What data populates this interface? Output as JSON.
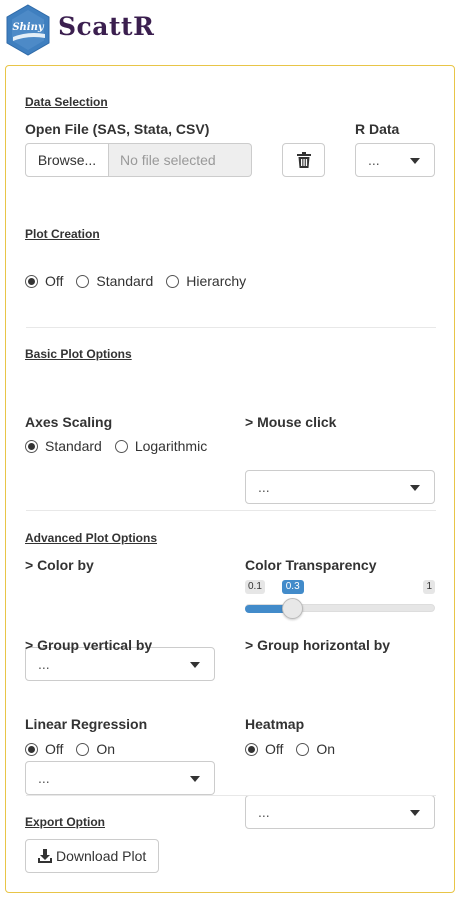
{
  "app": {
    "title": "ScattR",
    "logo_text": "Shiny"
  },
  "data_selection": {
    "section_title": "Data Selection",
    "open_file_label": "Open File (SAS, Stata, CSV)",
    "browse_label": "Browse...",
    "file_placeholder": "No file selected",
    "r_data_label": "R Data",
    "r_data_selected": "..."
  },
  "plot_creation": {
    "section_title": "Plot Creation",
    "options": [
      "Off",
      "Standard",
      "Hierarchy"
    ],
    "selected": "Off"
  },
  "basic_options": {
    "section_title": "Basic Plot Options",
    "axes_scaling_label": "Axes Scaling",
    "axes_options": [
      "Standard",
      "Logarithmic"
    ],
    "axes_selected": "Standard",
    "mouse_click_label": "> Mouse click",
    "mouse_click_selected": "..."
  },
  "advanced_options": {
    "section_title": "Advanced Plot Options",
    "color_by_label": "> Color by",
    "color_by_selected": "...",
    "transparency_label": "Color Transparency",
    "transparency_min": "0.1",
    "transparency_max": "1",
    "transparency_value": "0.3",
    "transparency_fraction": 0.222,
    "group_vertical_label": "> Group vertical by",
    "group_vertical_selected": "...",
    "group_horizontal_label": "> Group horizontal by",
    "group_horizontal_selected": "...",
    "linear_regression_label": "Linear Regression",
    "linear_regression_options": [
      "Off",
      "On"
    ],
    "linear_regression_selected": "Off",
    "heatmap_label": "Heatmap",
    "heatmap_options": [
      "Off",
      "On"
    ],
    "heatmap_selected": "Off"
  },
  "export": {
    "section_title": "Export Option",
    "download_label": "Download Plot"
  },
  "colors": {
    "panel_border": "#e8c547",
    "accent": "#428bca",
    "logo": "#3f7fbf",
    "title": "#3b1f4f"
  }
}
